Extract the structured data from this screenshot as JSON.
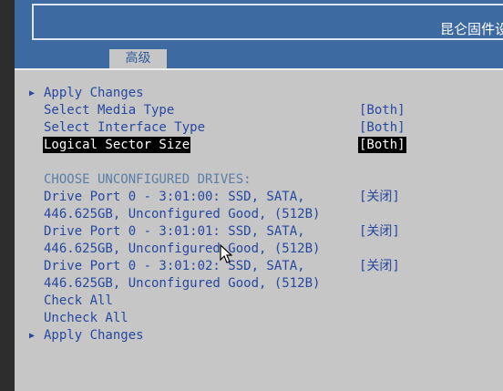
{
  "header": {
    "title": "昆仑固件设置"
  },
  "tab": {
    "label": "高级"
  },
  "menu": {
    "apply_changes_top": "Apply Changes",
    "select_media_type": "Select Media Type",
    "select_media_type_value": "[Both]",
    "select_interface_type": "Select Interface Type",
    "select_interface_type_value": "[Both]",
    "logical_sector_size": "Logical Sector Size",
    "logical_sector_size_value": "[Both]",
    "unconfigured_heading": "CHOOSE UNCONFIGURED DRIVES:",
    "drives": [
      {
        "line1": "Drive Port 0 - 3:01:00: SSD, SATA,",
        "line2": "446.625GB, Unconfigured Good, (512B)",
        "value": "[关闭]"
      },
      {
        "line1": "Drive Port 0 - 3:01:01: SSD, SATA,",
        "line2": "446.625GB, Unconfigured Good, (512B)",
        "value": "[关闭]"
      },
      {
        "line1": "Drive Port 0 - 3:01:02: SSD, SATA,",
        "line2": "446.625GB, Unconfigured Good, (512B)",
        "value": "[关闭]"
      }
    ],
    "check_all": "Check All",
    "uncheck_all": "Uncheck All",
    "apply_changes_bottom": "Apply Changes"
  },
  "icons": {
    "submenu": "triangle-right-icon",
    "pointer": "mouse-cursor-icon"
  },
  "colors": {
    "header_bg": "#3d6aa0",
    "body_bg": "#c6c6c6",
    "text": "#2548a0",
    "heading": "#5a7ea6",
    "highlight_bg": "#000000",
    "highlight_fg": "#ffffff"
  }
}
